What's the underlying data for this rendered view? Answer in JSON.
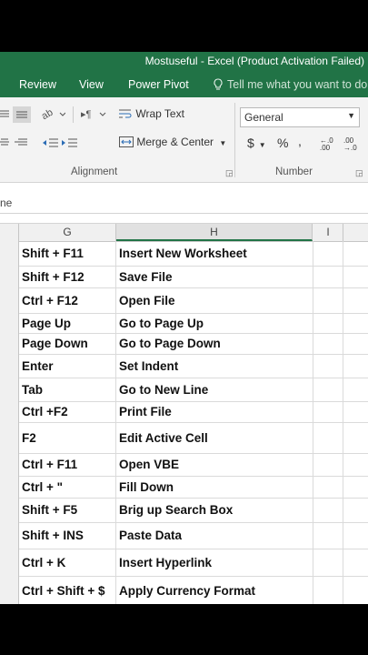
{
  "window": {
    "title": "Mostuseful - Excel (Product Activation Failed)"
  },
  "ribbon_tabs": [
    "Review",
    "View",
    "Power Pivot"
  ],
  "tell_me": "Tell me what you want to do...",
  "ribbon": {
    "wrap_text": "Wrap Text",
    "merge_center": "Merge & Center",
    "number_format": "General",
    "currency_symbol": "$",
    "percent_symbol": "%",
    "comma_symbol": ",",
    "increase_decimal": "←.0 .00",
    "decrease_decimal": ".00 →.0",
    "groups": {
      "alignment": "Alignment",
      "number": "Number"
    }
  },
  "formula_bar": {
    "name_box_fragment": "ne"
  },
  "columns": [
    "G",
    "H",
    "I"
  ],
  "rows": [
    {
      "shortcut": "Shift + F11",
      "action": "Insert New Worksheet"
    },
    {
      "shortcut": "Shift + F12",
      "action": "Save File"
    },
    {
      "shortcut": "Ctrl + F12",
      "action": "Open File"
    },
    {
      "shortcut": "Page Up",
      "action": "Go to Page Up"
    },
    {
      "shortcut": "Page Down",
      "action": "Go to Page Down"
    },
    {
      "shortcut": "Enter",
      "action": "Set Indent"
    },
    {
      "shortcut": "Tab",
      "action": "Go to New Line"
    },
    {
      "shortcut": "Ctrl +F2",
      "action": "Print File"
    },
    {
      "shortcut": "F2",
      "action": "Edit Active Cell"
    },
    {
      "shortcut": "Ctrl + F11",
      "action": "Open VBE"
    },
    {
      "shortcut": "Ctrl + \"",
      "action": "Fill Down"
    },
    {
      "shortcut": "Shift + F5",
      "action": "Brig up Search Box"
    },
    {
      "shortcut": "Shift + INS",
      "action": "Paste Data"
    },
    {
      "shortcut": "Ctrl + K",
      "action": "Insert Hyperlink"
    },
    {
      "shortcut": "Ctrl + Shift + $",
      "action": "Apply Currency Format"
    }
  ],
  "colors": {
    "excel_green": "#217346",
    "ribbon_bg": "#f3f3f3",
    "header_bg": "#f0f0f0"
  }
}
